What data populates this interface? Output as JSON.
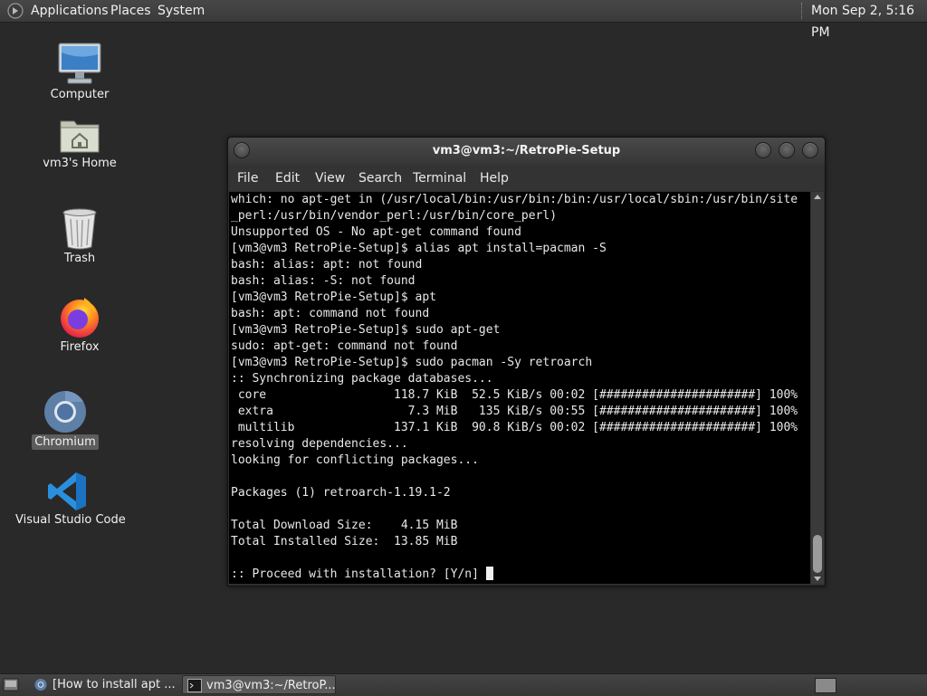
{
  "top_panel": {
    "menus": {
      "applications": "Applications",
      "places": "Places",
      "system": "System"
    },
    "clock": "Mon Sep  2,  5:16 PM"
  },
  "desktop": {
    "icons": [
      {
        "label": "Computer",
        "icon": "computer-icon"
      },
      {
        "label": "vm3's Home",
        "icon": "home-folder-icon"
      },
      {
        "label": "Trash",
        "icon": "trash-icon"
      },
      {
        "label": "Firefox",
        "icon": "firefox-icon"
      },
      {
        "label": "Chromium",
        "icon": "chromium-icon",
        "selected": true
      },
      {
        "label": "Visual Studio Code",
        "icon": "vscode-icon"
      }
    ]
  },
  "terminal": {
    "title": "vm3@vm3:~/RetroPie-Setup",
    "menu": [
      "File",
      "Edit",
      "View",
      "Search",
      "Terminal",
      "Help"
    ],
    "lines": [
      "which: no apt-get in (/usr/local/bin:/usr/bin:/bin:/usr/local/sbin:/usr/bin/site",
      "_perl:/usr/bin/vendor_perl:/usr/bin/core_perl)",
      "Unsupported OS - No apt-get command found",
      "[vm3@vm3 RetroPie-Setup]$ alias apt install=pacman -S",
      "bash: alias: apt: not found",
      "bash: alias: -S: not found",
      "[vm3@vm3 RetroPie-Setup]$ apt",
      "bash: apt: command not found",
      "[vm3@vm3 RetroPie-Setup]$ sudo apt-get",
      "sudo: apt-get: command not found",
      "[vm3@vm3 RetroPie-Setup]$ sudo pacman -Sy retroarch",
      ":: Synchronizing package databases...",
      " core                  118.7 KiB  52.5 KiB/s 00:02 [######################] 100%",
      " extra                   7.3 MiB   135 KiB/s 00:55 [######################] 100%",
      " multilib              137.1 KiB  90.8 KiB/s 00:02 [######################] 100%",
      "resolving dependencies...",
      "looking for conflicting packages...",
      "",
      "Packages (1) retroarch-1.19.1-2",
      "",
      "Total Download Size:    4.15 MiB",
      "Total Installed Size:  13.85 MiB",
      "",
      ":: Proceed with installation? [Y/n] "
    ]
  },
  "taskbar": {
    "tasks": [
      {
        "label": "[How to install apt ...",
        "icon": "chromium-icon",
        "active": false
      },
      {
        "label": "vm3@vm3:~/RetroP...",
        "icon": "terminal-icon",
        "active": true
      }
    ]
  }
}
